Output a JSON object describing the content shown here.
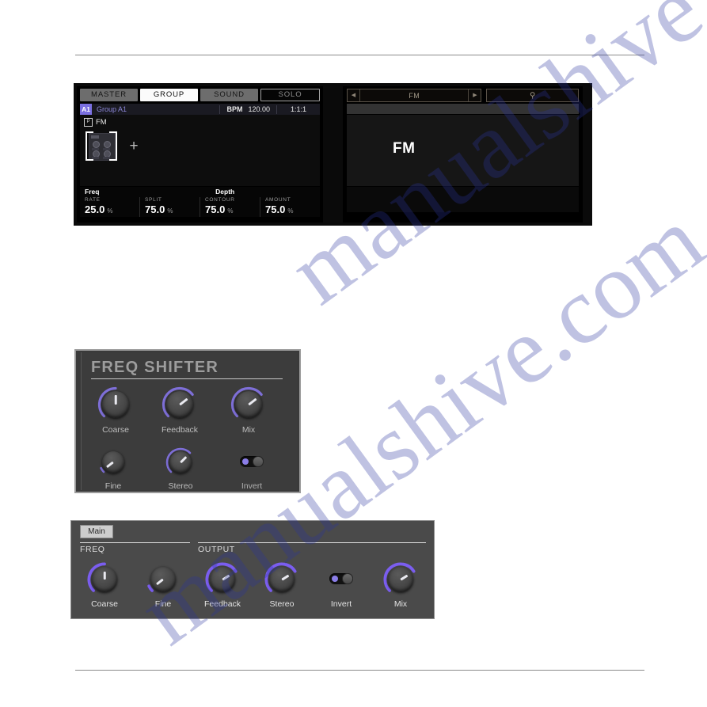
{
  "maschine_display": {
    "tabs": [
      {
        "label": "MASTER",
        "state": "inactive"
      },
      {
        "label": "GROUP",
        "state": "active"
      },
      {
        "label": "SOUND",
        "state": "inactive"
      },
      {
        "label": "SOLO",
        "state": "outline"
      }
    ],
    "group_row": {
      "badge": "A1",
      "name": "Group A1",
      "bpm_label": "BPM",
      "bpm_value": "120.00",
      "position": "1:1:1"
    },
    "slot": {
      "icon_glyph": "P",
      "label": "FM",
      "add_glyph": "+"
    },
    "parameter_footer": {
      "group_titles": [
        "Freq",
        "Depth"
      ],
      "cells": [
        {
          "caption": "RATE",
          "value": "25.0",
          "unit": "%"
        },
        {
          "caption": "SPLIT",
          "value": "75.0",
          "unit": "%"
        },
        {
          "caption": "CONTOUR",
          "value": "75.0",
          "unit": "%"
        },
        {
          "caption": "AMOUNT",
          "value": "75.0",
          "unit": "%"
        }
      ]
    },
    "browser": {
      "prev_glyph": "◀",
      "next_glyph": "▶",
      "nav_text": "FM",
      "search_glyph": "⚲",
      "big_name": "FM"
    }
  },
  "freq_shifter": {
    "title": "FREQ SHIFTER",
    "knobs": [
      {
        "label": "Coarse",
        "angle": 0,
        "arc_start": 225,
        "arc_end": 360,
        "accent": "#7e6fd8"
      },
      {
        "label": "Feedback",
        "angle": 52,
        "arc_start": 225,
        "arc_end": 412,
        "accent": "#7e6fd8"
      },
      {
        "label": "Mix",
        "angle": 52,
        "arc_start": 225,
        "arc_end": 412,
        "accent": "#7e6fd8"
      },
      {
        "label": "Fine",
        "angle": -128,
        "arc_start": 225,
        "arc_end": 245,
        "accent": "#7e6fd8"
      },
      {
        "label": "Stereo",
        "angle": 45,
        "arc_start": 225,
        "arc_end": 405,
        "accent": "#7e6fd8"
      }
    ],
    "toggle": {
      "label": "Invert",
      "state": "off",
      "accent": "#8b7ee8"
    }
  },
  "plugin_strip": {
    "tab": "Main",
    "sections": [
      {
        "label": "FREQ"
      },
      {
        "label": "OUTPUT"
      }
    ],
    "knobs": [
      {
        "label": "Coarse",
        "angle": 0,
        "arc_start": 225,
        "arc_end": 360,
        "accent": "#7b5ef0"
      },
      {
        "label": "Fine",
        "angle": -128,
        "arc_start": 225,
        "arc_end": 245,
        "accent": "#7b5ef0"
      },
      {
        "label": "Feedback",
        "angle": 58,
        "arc_start": 225,
        "arc_end": 418,
        "accent": "#7b5ef0"
      },
      {
        "label": "Stereo",
        "angle": 58,
        "arc_start": 225,
        "arc_end": 418,
        "accent": "#7b5ef0"
      },
      {
        "label": "Mix",
        "angle": 58,
        "arc_start": 225,
        "arc_end": 418,
        "accent": "#7b5ef0"
      }
    ],
    "toggle": {
      "label": "Invert",
      "state": "off",
      "accent": "#7b5ef0"
    }
  },
  "watermark": {
    "line1": "manualshive.com",
    "line2": "manualshive.com"
  }
}
